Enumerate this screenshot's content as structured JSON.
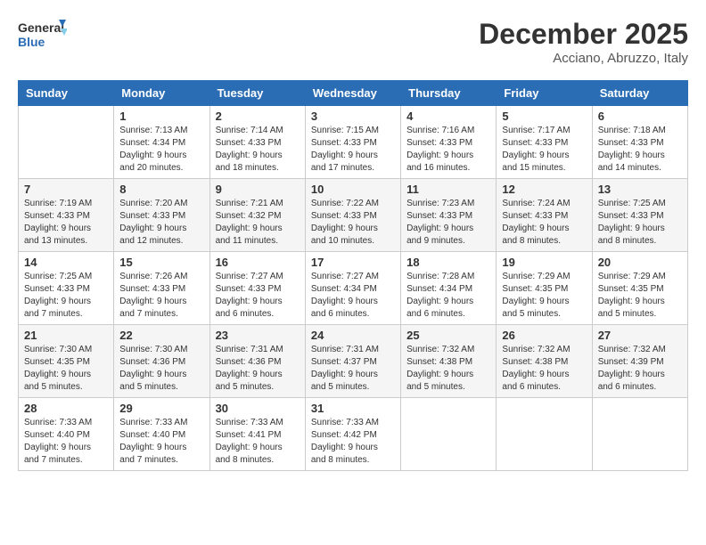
{
  "header": {
    "logo_general": "General",
    "logo_blue": "Blue",
    "month_title": "December 2025",
    "location": "Acciano, Abruzzo, Italy"
  },
  "calendar": {
    "days_of_week": [
      "Sunday",
      "Monday",
      "Tuesday",
      "Wednesday",
      "Thursday",
      "Friday",
      "Saturday"
    ],
    "weeks": [
      [
        {
          "day": "",
          "info": ""
        },
        {
          "day": "1",
          "info": "Sunrise: 7:13 AM\nSunset: 4:34 PM\nDaylight: 9 hours\nand 20 minutes."
        },
        {
          "day": "2",
          "info": "Sunrise: 7:14 AM\nSunset: 4:33 PM\nDaylight: 9 hours\nand 18 minutes."
        },
        {
          "day": "3",
          "info": "Sunrise: 7:15 AM\nSunset: 4:33 PM\nDaylight: 9 hours\nand 17 minutes."
        },
        {
          "day": "4",
          "info": "Sunrise: 7:16 AM\nSunset: 4:33 PM\nDaylight: 9 hours\nand 16 minutes."
        },
        {
          "day": "5",
          "info": "Sunrise: 7:17 AM\nSunset: 4:33 PM\nDaylight: 9 hours\nand 15 minutes."
        },
        {
          "day": "6",
          "info": "Sunrise: 7:18 AM\nSunset: 4:33 PM\nDaylight: 9 hours\nand 14 minutes."
        }
      ],
      [
        {
          "day": "7",
          "info": "Sunrise: 7:19 AM\nSunset: 4:33 PM\nDaylight: 9 hours\nand 13 minutes."
        },
        {
          "day": "8",
          "info": "Sunrise: 7:20 AM\nSunset: 4:33 PM\nDaylight: 9 hours\nand 12 minutes."
        },
        {
          "day": "9",
          "info": "Sunrise: 7:21 AM\nSunset: 4:32 PM\nDaylight: 9 hours\nand 11 minutes."
        },
        {
          "day": "10",
          "info": "Sunrise: 7:22 AM\nSunset: 4:33 PM\nDaylight: 9 hours\nand 10 minutes."
        },
        {
          "day": "11",
          "info": "Sunrise: 7:23 AM\nSunset: 4:33 PM\nDaylight: 9 hours\nand 9 minutes."
        },
        {
          "day": "12",
          "info": "Sunrise: 7:24 AM\nSunset: 4:33 PM\nDaylight: 9 hours\nand 8 minutes."
        },
        {
          "day": "13",
          "info": "Sunrise: 7:25 AM\nSunset: 4:33 PM\nDaylight: 9 hours\nand 8 minutes."
        }
      ],
      [
        {
          "day": "14",
          "info": "Sunrise: 7:25 AM\nSunset: 4:33 PM\nDaylight: 9 hours\nand 7 minutes."
        },
        {
          "day": "15",
          "info": "Sunrise: 7:26 AM\nSunset: 4:33 PM\nDaylight: 9 hours\nand 7 minutes."
        },
        {
          "day": "16",
          "info": "Sunrise: 7:27 AM\nSunset: 4:33 PM\nDaylight: 9 hours\nand 6 minutes."
        },
        {
          "day": "17",
          "info": "Sunrise: 7:27 AM\nSunset: 4:34 PM\nDaylight: 9 hours\nand 6 minutes."
        },
        {
          "day": "18",
          "info": "Sunrise: 7:28 AM\nSunset: 4:34 PM\nDaylight: 9 hours\nand 6 minutes."
        },
        {
          "day": "19",
          "info": "Sunrise: 7:29 AM\nSunset: 4:35 PM\nDaylight: 9 hours\nand 5 minutes."
        },
        {
          "day": "20",
          "info": "Sunrise: 7:29 AM\nSunset: 4:35 PM\nDaylight: 9 hours\nand 5 minutes."
        }
      ],
      [
        {
          "day": "21",
          "info": "Sunrise: 7:30 AM\nSunset: 4:35 PM\nDaylight: 9 hours\nand 5 minutes."
        },
        {
          "day": "22",
          "info": "Sunrise: 7:30 AM\nSunset: 4:36 PM\nDaylight: 9 hours\nand 5 minutes."
        },
        {
          "day": "23",
          "info": "Sunrise: 7:31 AM\nSunset: 4:36 PM\nDaylight: 9 hours\nand 5 minutes."
        },
        {
          "day": "24",
          "info": "Sunrise: 7:31 AM\nSunset: 4:37 PM\nDaylight: 9 hours\nand 5 minutes."
        },
        {
          "day": "25",
          "info": "Sunrise: 7:32 AM\nSunset: 4:38 PM\nDaylight: 9 hours\nand 5 minutes."
        },
        {
          "day": "26",
          "info": "Sunrise: 7:32 AM\nSunset: 4:38 PM\nDaylight: 9 hours\nand 6 minutes."
        },
        {
          "day": "27",
          "info": "Sunrise: 7:32 AM\nSunset: 4:39 PM\nDaylight: 9 hours\nand 6 minutes."
        }
      ],
      [
        {
          "day": "28",
          "info": "Sunrise: 7:33 AM\nSunset: 4:40 PM\nDaylight: 9 hours\nand 7 minutes."
        },
        {
          "day": "29",
          "info": "Sunrise: 7:33 AM\nSunset: 4:40 PM\nDaylight: 9 hours\nand 7 minutes."
        },
        {
          "day": "30",
          "info": "Sunrise: 7:33 AM\nSunset: 4:41 PM\nDaylight: 9 hours\nand 8 minutes."
        },
        {
          "day": "31",
          "info": "Sunrise: 7:33 AM\nSunset: 4:42 PM\nDaylight: 9 hours\nand 8 minutes."
        },
        {
          "day": "",
          "info": ""
        },
        {
          "day": "",
          "info": ""
        },
        {
          "day": "",
          "info": ""
        }
      ]
    ]
  }
}
